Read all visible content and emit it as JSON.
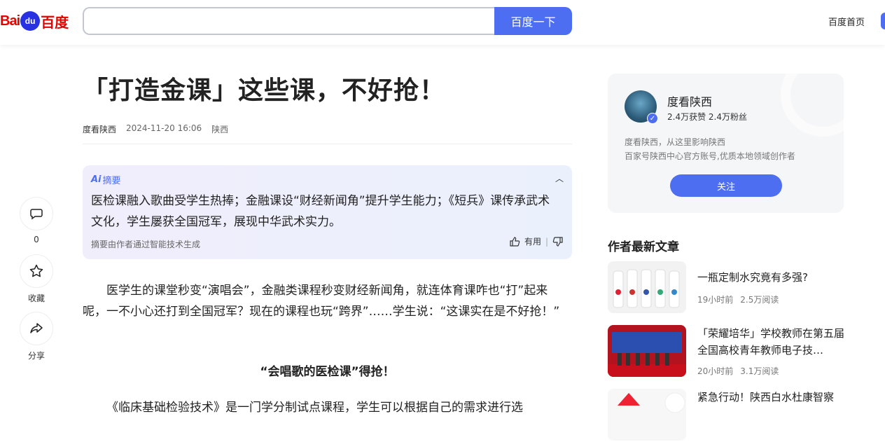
{
  "header": {
    "logo_text_bai": "Bai",
    "logo_text_du": "du",
    "logo_text_cn": "百度",
    "search_placeholder": "",
    "search_button": "百度一下",
    "home_link": "百度首页"
  },
  "article": {
    "title": "「打造金课」这些课，不好抢！",
    "author": "度看陕西",
    "date": "2024-11-20 16:06",
    "location": "陕西",
    "summary": {
      "label": "摘要",
      "text": "医检课融入歌曲受学生热捧；金融课设“财经新闻角”提升学生能力；《短兵》课传承武术文化，学生屡获全国冠军，展现中华武术实力。",
      "footnote": "摘要由作者通过智能技术生成",
      "useful_label": "有用"
    },
    "paragraph1": "医学生的课堂秒变“演唱会”，金融类课程秒变财经新闻角，就连体育课咋也“打”起来呢，一不小心还打到全国冠军？现在的课程也玩“跨界”……学生说：“这课实在是不好抢！”",
    "subheading": "“会唱歌的医检课”得抢！",
    "paragraph2": "《临床基础检验技术》是一门学分制试点课程，学生可以根据自己的需求进行选"
  },
  "actions": {
    "comment_count": "0",
    "favorite_label": "收藏",
    "share_label": "分享"
  },
  "author_card": {
    "name": "度看陕西",
    "stats": "2.4万获赞 2.4万粉丝",
    "desc1": "度看陕西，从这里影响陕西",
    "desc2": "百家号陕西中心官方账号,优质本地领域创作者",
    "follow_button": "关注"
  },
  "latest": {
    "heading": "作者最新文章",
    "items": [
      {
        "title": "一瓶定制水究竟有多强?",
        "time": "19小时前",
        "reads": "2.5万阅读"
      },
      {
        "title": "「荣耀培华」学校教师在第五届全国高校青年教师电子技…",
        "time": "20小时前",
        "reads": "3.1万阅读"
      },
      {
        "title": "紧急行动！陕西白水杜康智察",
        "time": "",
        "reads": ""
      }
    ]
  },
  "colors": {
    "accent": "#4e6ef2",
    "brand_red": "#e10601"
  }
}
